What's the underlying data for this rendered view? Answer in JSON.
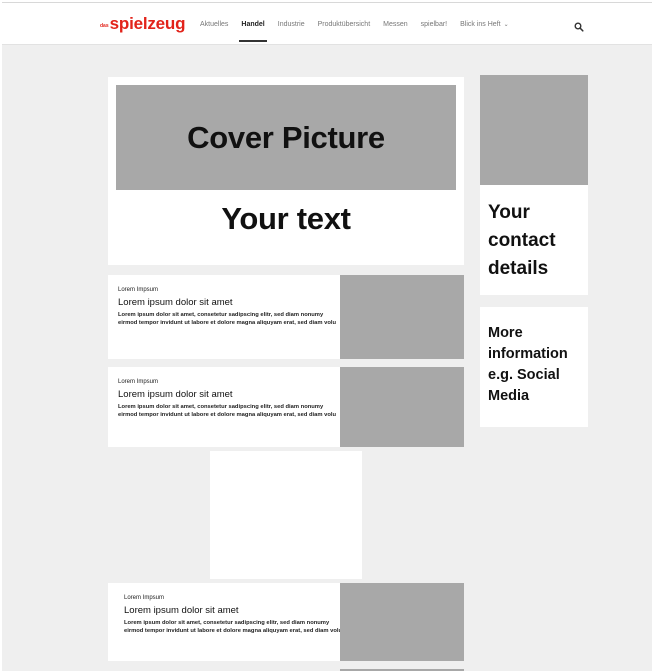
{
  "header": {
    "logo_prefix": "das",
    "logo_word": "spielzeug",
    "nav": [
      {
        "label": "Aktuelles"
      },
      {
        "label": "Handel",
        "active": true
      },
      {
        "label": "Industrie"
      },
      {
        "label": "Produktübersicht"
      },
      {
        "label": "Messen"
      },
      {
        "label": "spielbar!"
      },
      {
        "label": "Blick ins Heft",
        "has_dropdown": true
      }
    ],
    "search_icon": "search-icon",
    "dropdown_icon": "chevron-down-icon"
  },
  "hero": {
    "cover_label": "Cover Picture",
    "text": "Your text"
  },
  "sidebar": {
    "contact_text": "Your contact details",
    "more_text": "More information e.g. Social Media"
  },
  "articles": [
    {
      "kicker": "Lorem Impsum",
      "title": "Lorem ipsum dolor sit amet",
      "body": "Lorem ipsum dolor sit amet, consetetur sadipscing elitr, sed diam nonumy eirmod tempor invidunt ut labore et dolore magna aliquyam erat, sed diam volu"
    },
    {
      "kicker": "Lorem Impsum",
      "title": "Lorem ipsum dolor sit amet",
      "body": "Lorem ipsum dolor sit amet, consetetur sadipscing elitr, sed diam nonumy eirmod tempor invidunt ut labore et dolore magna aliquyam erat, sed diam volu"
    },
    {
      "kicker": "Lorem Impsum",
      "title": "Lorem ipsum dolor sit amet",
      "body": "Lorem ipsum dolor sit amet, consetetur sadipscing elitr, sed diam nonumy eirmod tempor invidunt ut labore et dolore magna aliquyam erat, sed diam volu"
    }
  ],
  "colors": {
    "brand_red": "#e2231a",
    "placeholder_gray": "#a8a8a8",
    "page_background": "#efefef",
    "card_background": "#ffffff"
  }
}
